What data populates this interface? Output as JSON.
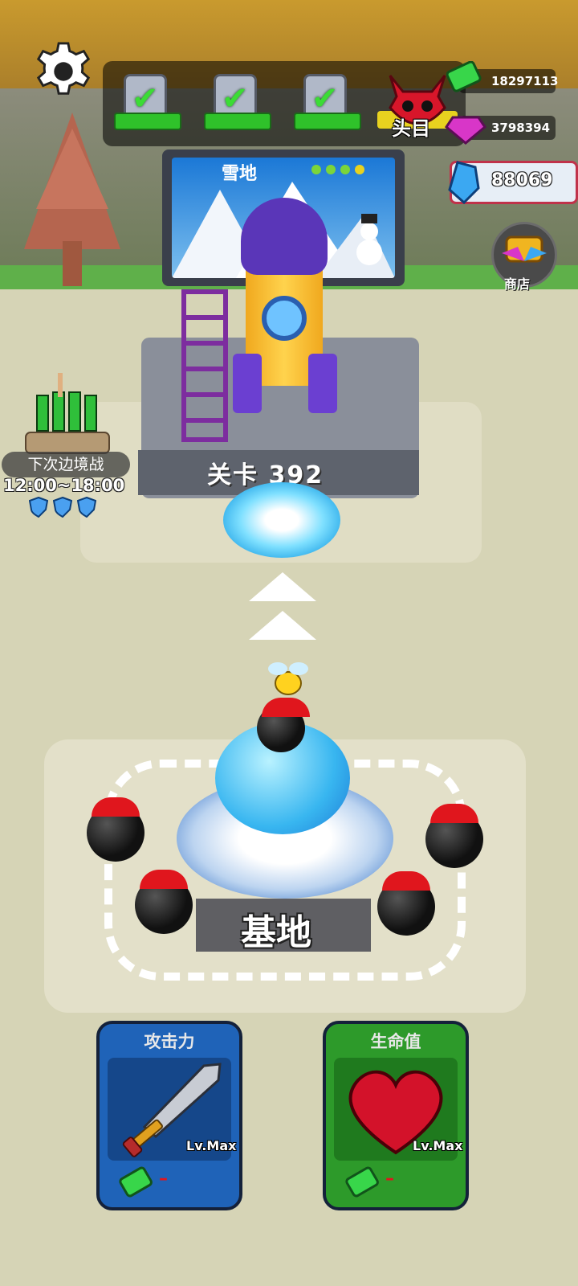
{
  "hud": {
    "settings_icon": "gear-icon",
    "chests": [
      {
        "name": "chest-1",
        "status": "checked"
      },
      {
        "name": "chest-2",
        "status": "checked"
      },
      {
        "name": "chest-3",
        "status": "checked"
      }
    ],
    "boss_label": "头目",
    "cash_amount": "18297113",
    "gem_amount": "3798394",
    "crystal_amount": "88069",
    "shop_label": "商店"
  },
  "stage": {
    "billboard_title": "雪地",
    "progress_dots": 4,
    "level_label": "关卡 392"
  },
  "border_battle": {
    "label": "下次边境战",
    "time": "12:00~18:00",
    "shields": 3
  },
  "base": {
    "label": "基地"
  },
  "upgrades": [
    {
      "title": "攻击力",
      "level": "Lv.Max",
      "cost": "–",
      "color": "#1f63b8",
      "icon": "sword-icon"
    },
    {
      "title": "生命值",
      "level": "Lv.Max",
      "cost": "–",
      "color": "#2d9a2a",
      "icon": "heart-icon"
    }
  ],
  "colors": {
    "accent_green": "#2fc22a",
    "boss_yellow": "#e8d21f",
    "crystal_border": "#c0324a"
  }
}
